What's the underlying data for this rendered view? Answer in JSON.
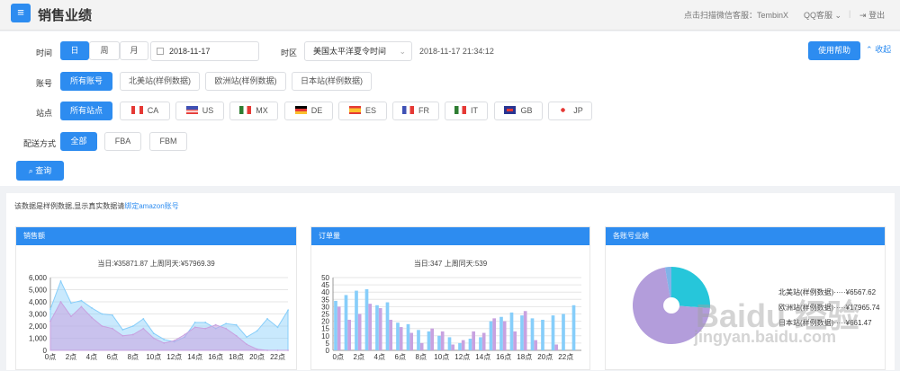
{
  "header": {
    "title": "销售业绩",
    "wechat": "点击扫描微信客服：TembinX",
    "qq": "QQ客服",
    "logout": "登出"
  },
  "filters": {
    "time_label": "时间",
    "time_tabs": [
      "日",
      "周",
      "月"
    ],
    "date": "2018-11-17",
    "tz_label": "时区",
    "tz_value": "美国太平洋夏令时间",
    "datetime": "2018-11-17 21:34:12",
    "help": "使用帮助",
    "collapse": "收起",
    "account_label": "账号",
    "accounts": [
      "所有账号",
      "北美站(样例数据)",
      "欧洲站(样例数据)",
      "日本站(样例数据)"
    ],
    "site_label": "站点",
    "all_sites": "所有站点",
    "sites": [
      "CA",
      "US",
      "MX",
      "DE",
      "ES",
      "FR",
      "IT",
      "GB",
      "JP"
    ],
    "ship_label": "配送方式",
    "ship": [
      "全部",
      "FBA",
      "FBM"
    ],
    "query": "查询"
  },
  "notice": {
    "text": "该数据是样例数据,显示真实数据请",
    "link": "绑定amazon账号"
  },
  "sales": {
    "title": "销售额",
    "summary": "当日:¥35871.87    上周同天:¥57969.39"
  },
  "orders": {
    "title": "订单量",
    "summary": "当日:347    上周同天:539"
  },
  "accounts_card": {
    "title": "各账号业绩",
    "legend": [
      "北美站(样例数据)·····¥6567.62",
      "欧洲站(样例数据)·····¥17965.74",
      "日本站(样例数据)·····¥661.47"
    ]
  },
  "colors": {
    "accent": "#2d8cf0",
    "today": "#87cefa",
    "lastweek": "#c8a2e0",
    "slice1": "#b39ddb",
    "slice2": "#26c6da",
    "slice3": "#7fb3e8"
  },
  "watermark": {
    "brand": "Baidu 经验",
    "url": "jingyan.baidu.com"
  },
  "chart_data": [
    {
      "type": "area",
      "x": [
        "0点",
        "1点",
        "2点",
        "3点",
        "4点",
        "5点",
        "6点",
        "7点",
        "8点",
        "9点",
        "10点",
        "11点",
        "12点",
        "13点",
        "14点",
        "15点",
        "16点",
        "17点",
        "18点",
        "19点",
        "20点",
        "21点",
        "22点",
        "23点"
      ],
      "ylim": [
        0,
        6000
      ],
      "ticks": [
        0,
        1000,
        2000,
        3000,
        4000,
        5000,
        6000
      ],
      "series": [
        {
          "name": "当日",
          "values": [
            3400,
            5700,
            3900,
            4100,
            3500,
            3000,
            2900,
            1700,
            2000,
            2600,
            1400,
            900,
            700,
            1100,
            2300,
            2300,
            1800,
            2200,
            2100,
            1100,
            1600,
            2600,
            1900,
            3300
          ]
        },
        {
          "name": "上周同天",
          "values": [
            2400,
            4000,
            2800,
            3600,
            2700,
            2000,
            1800,
            1200,
            1300,
            1800,
            1000,
            600,
            800,
            1300,
            1900,
            1800,
            2100,
            1800,
            1200,
            500,
            100,
            0,
            0,
            0
          ]
        }
      ]
    },
    {
      "type": "bar",
      "x": [
        "0点",
        "1点",
        "2点",
        "3点",
        "4点",
        "5点",
        "6点",
        "7点",
        "8点",
        "9点",
        "10点",
        "11点",
        "12点",
        "13点",
        "14点",
        "15点",
        "16点",
        "17点",
        "18点",
        "19点",
        "20点",
        "21点",
        "22点",
        "23点"
      ],
      "ylim": [
        0,
        50
      ],
      "ticks": [
        0,
        5,
        10,
        15,
        20,
        25,
        30,
        35,
        40,
        45,
        50
      ],
      "series": [
        {
          "name": "当日",
          "values": [
            34,
            38,
            41,
            42,
            31,
            33,
            19,
            18,
            14,
            13,
            10,
            9,
            5,
            8,
            9,
            20,
            23,
            26,
            24,
            22,
            21,
            24,
            25,
            31
          ]
        },
        {
          "name": "上周同天",
          "values": [
            30,
            21,
            25,
            32,
            29,
            21,
            16,
            12,
            5,
            15,
            13,
            4,
            7,
            13,
            12,
            22,
            20,
            13,
            27,
            7,
            0,
            4,
            0,
            0
          ]
        }
      ]
    },
    {
      "type": "pie",
      "labels": [
        "北美站(样例数据)",
        "欧洲站(样例数据)",
        "日本站(样例数据)"
      ],
      "values": [
        6567.62,
        17965.74,
        661.47
      ]
    }
  ]
}
